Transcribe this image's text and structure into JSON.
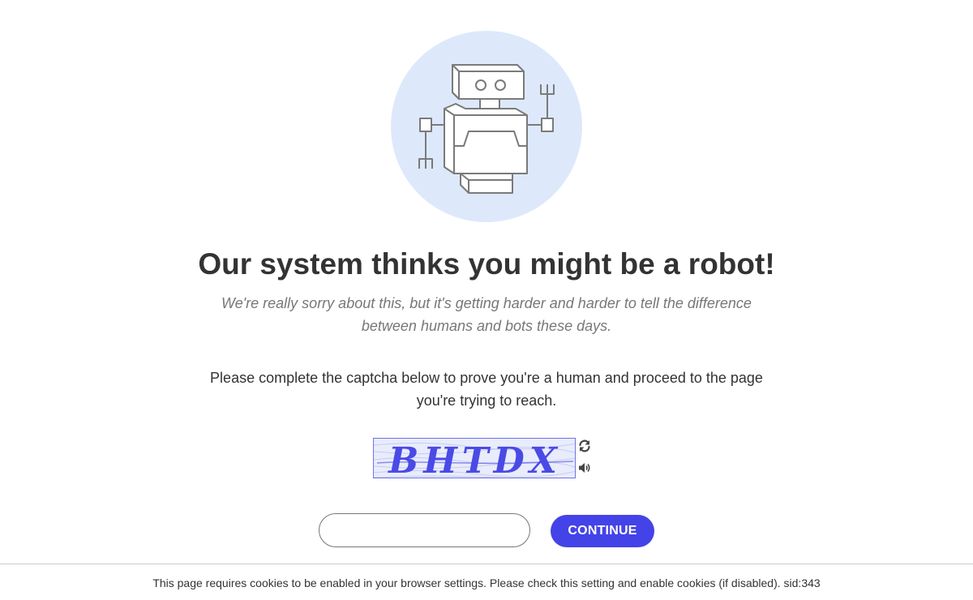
{
  "hero": {
    "illustration": "robot-icon",
    "circle_color": "#dde9fb"
  },
  "heading": "Our system thinks you might be a robot!",
  "apology": "We're really sorry about this, but it's getting harder and harder to tell the difference between humans and bots these days.",
  "instructions": "Please complete the captcha below to prove you're a human and proceed to the page you're trying to reach.",
  "captcha": {
    "text": "BHTDX",
    "refresh_icon": "refresh-icon",
    "audio_icon": "speaker-icon"
  },
  "form": {
    "input_value": "",
    "continue_label": "CONTINUE",
    "accent_color": "#4343e8"
  },
  "footer": {
    "text": "This page requires cookies to be enabled in your browser settings. Please check this setting and enable cookies (if disabled). sid:343"
  }
}
